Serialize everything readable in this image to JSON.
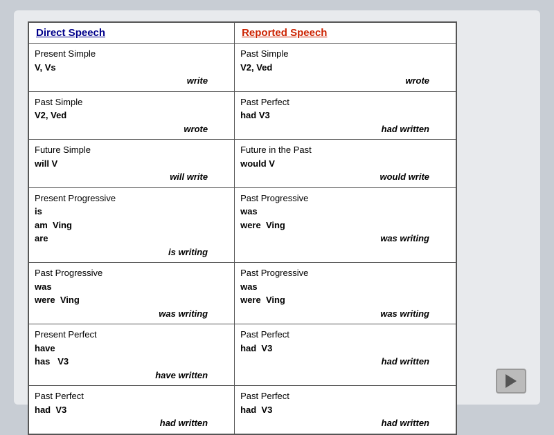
{
  "header": {
    "direct_label": "Direct Speech",
    "reported_label": "Reported Speech"
  },
  "rows": [
    {
      "direct_tense": "Present Simple",
      "direct_forms": "V, Vs",
      "direct_example": "write",
      "reported_tense": "Past Simple",
      "reported_forms": "V2, Ved",
      "reported_example": "wrote"
    },
    {
      "direct_tense": "Past Simple",
      "direct_forms": "V2, Ved",
      "direct_example": "wrote",
      "reported_tense": "Past Perfect",
      "reported_forms": "had V3",
      "reported_example": "had written"
    },
    {
      "direct_tense": "Future Simple",
      "direct_forms": "will V",
      "direct_example": "will write",
      "reported_tense": "Future in the Past",
      "reported_forms": "would V",
      "reported_example": "would write"
    },
    {
      "direct_tense": "Present Progressive",
      "direct_forms": "is\nam  Ving\nare",
      "direct_example": "is writing",
      "reported_tense": "Past Progressive",
      "reported_forms": "was\nwere  Ving",
      "reported_example": "was writing"
    },
    {
      "direct_tense": "Past Progressive",
      "direct_forms": "was\nwere  Ving",
      "direct_example": "was writing",
      "reported_tense": "Past Progressive",
      "reported_forms": "was\nwere  Ving",
      "reported_example": "was writing"
    },
    {
      "direct_tense": "Present Perfect",
      "direct_forms": "have\nhas   V3",
      "direct_example": "have written",
      "reported_tense": "Past Perfect",
      "reported_forms": "had  V3",
      "reported_example": "had written"
    },
    {
      "direct_tense": "Past Perfect",
      "direct_forms": "had  V3",
      "direct_example": "had written",
      "reported_tense": "Past Perfect",
      "reported_forms": "had  V3",
      "reported_example": "had written"
    }
  ],
  "play_button_label": "▶"
}
